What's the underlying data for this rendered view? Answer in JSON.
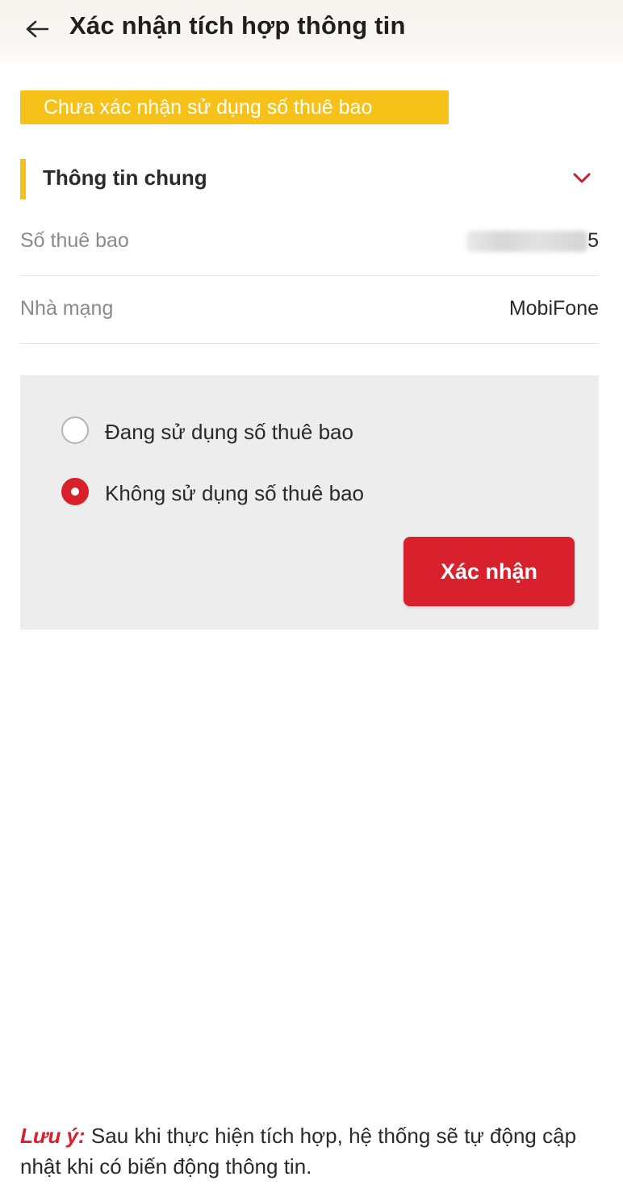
{
  "header": {
    "title": "Xác nhận tích hợp thông tin",
    "back_icon": "arrow-left-icon"
  },
  "status_badge": {
    "text": "Chưa xác nhận sử dụng số thuê bao",
    "color": "#f6c21a"
  },
  "section": {
    "title": "Thông tin chung",
    "toggle_icon": "chevron-down-icon",
    "accent_color": "#f6c21a"
  },
  "info_rows": [
    {
      "label": "Số thuê bao",
      "value_masked": true,
      "value_visible_tail": "5"
    },
    {
      "label": "Nhà mạng",
      "value": "MobiFone"
    }
  ],
  "options": {
    "items": [
      {
        "label": "Đang sử dụng số thuê bao",
        "selected": false
      },
      {
        "label": "Không sử dụng số thuê bao",
        "selected": true
      }
    ],
    "confirm_label": "Xác nhận",
    "confirm_color": "#d9212d"
  },
  "note": {
    "prefix": "Lưu ý:",
    "text": " Sau khi thực hiện tích hợp, hệ thống sẽ tự động cập nhật khi có biến động thông tin."
  }
}
